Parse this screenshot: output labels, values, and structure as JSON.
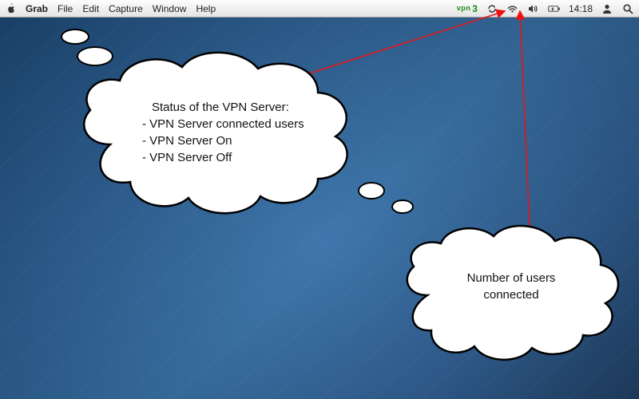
{
  "menubar": {
    "app": "Grab",
    "items": [
      "File",
      "Edit",
      "Capture",
      "Window",
      "Help"
    ],
    "vpn": {
      "label": "vpn",
      "count": "3"
    },
    "clock": "14:18"
  },
  "annotations": {
    "cloud1": {
      "heading": "Status of the VPN Server:",
      "lines": [
        "- VPN Server connected users",
        "- VPN Server On",
        "- VPN Server Off"
      ]
    },
    "cloud2": {
      "line1": "Number of users",
      "line2": "connected"
    }
  }
}
